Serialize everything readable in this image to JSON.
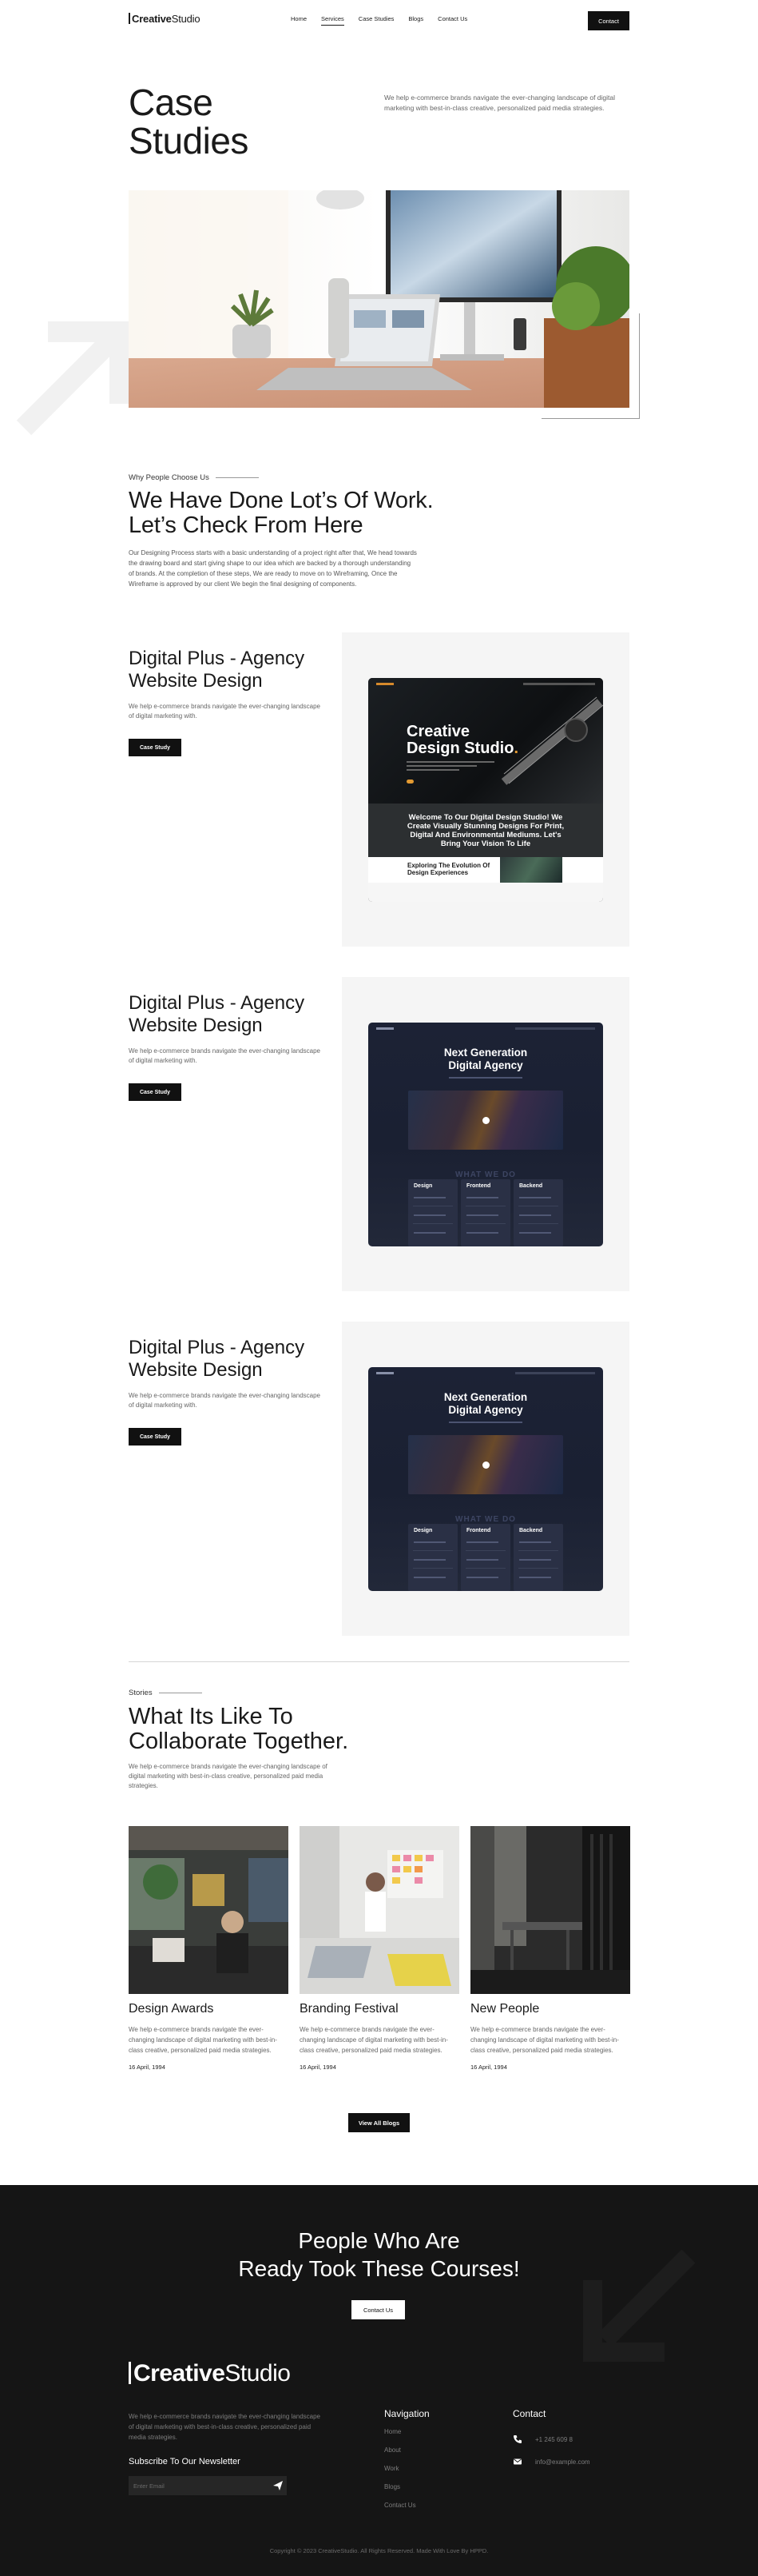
{
  "header": {
    "logo_bold": "Creative",
    "logo_light": "Studio",
    "nav": [
      "Home",
      "Services",
      "Case Studies",
      "Blogs",
      "Contact Us"
    ],
    "active_nav": "Services",
    "contact_label": "Contact"
  },
  "hero": {
    "title_line1": "Case",
    "title_line2": "Studies",
    "description": "We help e-commerce brands navigate the ever-changing landscape of digital marketing with best-in-class creative, personalized paid media strategies."
  },
  "why": {
    "eyebrow": "Why People Choose Us",
    "title_line1": "We Have Done Lot’s Of Work.",
    "title_line2": "Let’s Check From Here",
    "description": "Our Designing Process starts with a basic understanding of a project right after that, We head towards the drawing board and start giving shape to our idea which are backed by a thorough understanding of brands. At the completion of these steps, We are ready to move on to Wireframing, Once the Wireframe is approved by our client We begin the final designing of components."
  },
  "projects": [
    {
      "title": "Digital Plus - Agency Website Design",
      "description": "We help e-commerce brands navigate the ever-changing landscape of digital marketing with.",
      "button": "Case Study",
      "mock": {
        "headline_1": "Creative",
        "headline_2": "Design Studio",
        "headline_dot": ".",
        "banner": "Welcome To Our Digital Design Studio! We Create Visually Stunning Designs For Print, Digital And Environmental Mediums. Let's Bring Your Vision To Life",
        "footer": "Exploring The Evolution Of Design Experiences"
      }
    },
    {
      "title": "Digital Plus - Agency Website Design",
      "description": "We help e-commerce brands navigate the ever-changing landscape of digital marketing with.",
      "button": "Case Study",
      "mock": {
        "headline_1": "Next Generation",
        "headline_2": "Digital Agency",
        "section": "WHAT WE DO",
        "cards": [
          "Design",
          "Frontend",
          "Backend"
        ]
      }
    },
    {
      "title": "Digital Plus - Agency Website Design",
      "description": "We help e-commerce brands navigate the ever-changing landscape of digital marketing with.",
      "button": "Case Study",
      "mock": {
        "headline_1": "Next Generation",
        "headline_2": "Digital Agency",
        "section": "WHAT WE DO",
        "cards": [
          "Design",
          "Frontend",
          "Backend"
        ]
      }
    }
  ],
  "stories": {
    "eyebrow": "Stories",
    "title_line1": "What Its Like To",
    "title_line2": "Collaborate Together.",
    "description": "We help e-commerce brands navigate the ever-changing landscape of digital marketing with best-in-class creative, personalized paid media strategies.",
    "items": [
      {
        "title": "Design Awards",
        "text": "We help e-commerce brands navigate the ever-changing landscape of digital marketing with best-in-class creative, personalized paid media strategies.",
        "date": "16 April, 1994"
      },
      {
        "title": "Branding Festival",
        "text": "We help e-commerce brands navigate the ever-changing landscape of digital marketing with best-in-class creative, personalized paid media strategies.",
        "date": "16 April, 1994"
      },
      {
        "title": "New People",
        "text": "We help e-commerce brands navigate the ever-changing landscape of digital marketing with best-in-class creative, personalized paid media strategies.",
        "date": "16 April, 1994"
      }
    ],
    "view_all": "View All Blogs"
  },
  "footer": {
    "cta_line1": "People Who Are",
    "cta_line2": "Ready Took These Courses!",
    "cta_button": "Contact Us",
    "logo_bold": "Creative",
    "logo_light": "Studio",
    "description": "We help e-commerce brands navigate the ever-changing landscape of digital marketing with best-in-class creative, personalized paid media strategies.",
    "subscribe_title": "Subscribe To Our Newsletter",
    "email_placeholder": "Enter Email",
    "nav_title": "Navigation",
    "nav_links": [
      "Home",
      "About",
      "Work",
      "Blogs",
      "Contact Us"
    ],
    "contact_title": "Contact",
    "phone": "+1 245 609 8",
    "email": "info@example.com",
    "copyright": "Copyright © 2023 CreativeStudio. All Rights Reserved. Made With Love By HPPD."
  },
  "colors": {
    "dark": "#111111",
    "footer_bg": "#151515",
    "panel_bg": "#f5f5f5",
    "accent_orange": "#e39a32"
  }
}
